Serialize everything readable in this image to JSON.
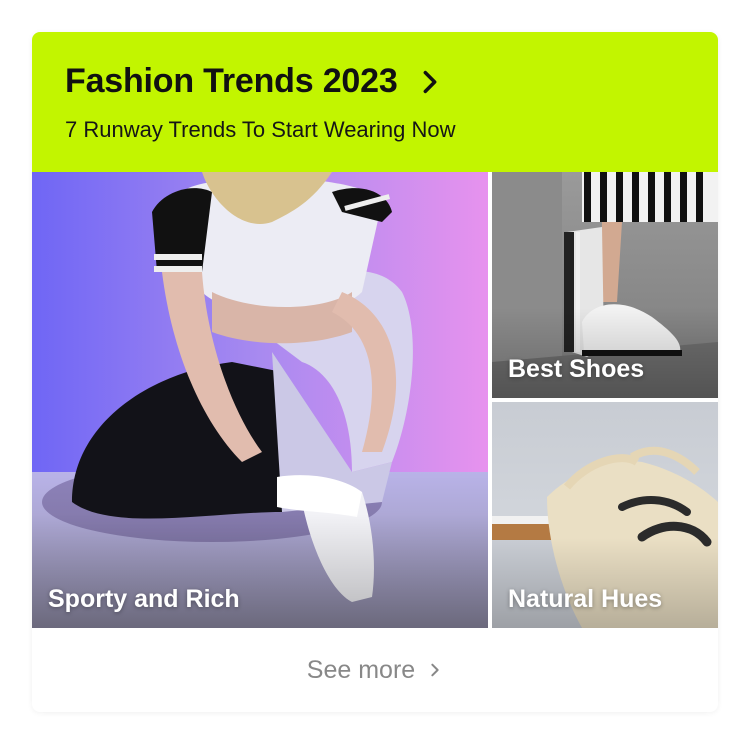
{
  "header": {
    "title": "Fashion Trends 2023",
    "subtitle": "7 Runway Trends To Start Wearing Now",
    "background_color": "#c2f500",
    "chevron_icon": "chevron-right-icon"
  },
  "tiles": [
    {
      "label": "Sporty and Rich"
    },
    {
      "label": "Best Shoes"
    },
    {
      "label": "Natural Hues"
    }
  ],
  "footer": {
    "see_more_label": "See more",
    "chevron_icon": "chevron-right-icon"
  }
}
